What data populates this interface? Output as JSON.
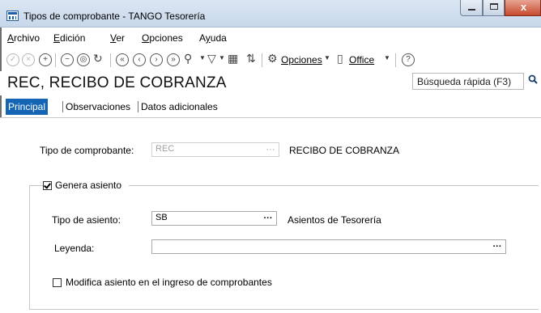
{
  "window": {
    "title": "Tipos de comprobante - TANGO Tesorería",
    "close_label": "x"
  },
  "menu": {
    "items": [
      {
        "label": "Archivo",
        "underline": "A",
        "rest": "rchivo"
      },
      {
        "label": "Edición",
        "underline": "E",
        "rest": "dición"
      },
      {
        "label": "Ver",
        "underline": "V",
        "rest": "er"
      },
      {
        "label": "Opciones",
        "underline": "O",
        "rest": "pciones"
      },
      {
        "label": "Ayuda",
        "pre": "A",
        "underline": "y",
        "rest": "uda"
      }
    ]
  },
  "toolbar": {
    "opciones_label": "Opciones",
    "office_label": "Office",
    "help_glyph": "?"
  },
  "header": {
    "title": "REC, RECIBO DE COBRANZA",
    "search_placeholder": "Búsqueda rápida (F3)"
  },
  "tabs": [
    {
      "label": "Principal",
      "active": true
    },
    {
      "label": "Observaciones",
      "active": false
    },
    {
      "label": "Datos adicionales",
      "active": false
    }
  ],
  "form": {
    "tipo_comprobante": {
      "label": "Tipo de comprobante:",
      "value": "REC",
      "description": "RECIBO DE COBRANZA",
      "dots": "···"
    },
    "genera_asiento": {
      "label": "Genera asiento",
      "checked": true
    },
    "tipo_asiento": {
      "label": "Tipo de asiento:",
      "value": "SB",
      "description": "Asientos de Tesorería",
      "dots": "···"
    },
    "leyenda": {
      "label": "Leyenda:",
      "value": "",
      "dots": "···"
    },
    "modifica_asiento": {
      "label": "Modifica asiento en el ingreso de comprobantes",
      "checked": false
    }
  },
  "colors": {
    "accent": "#1565b5",
    "titlebar": "#c7d7ea"
  }
}
